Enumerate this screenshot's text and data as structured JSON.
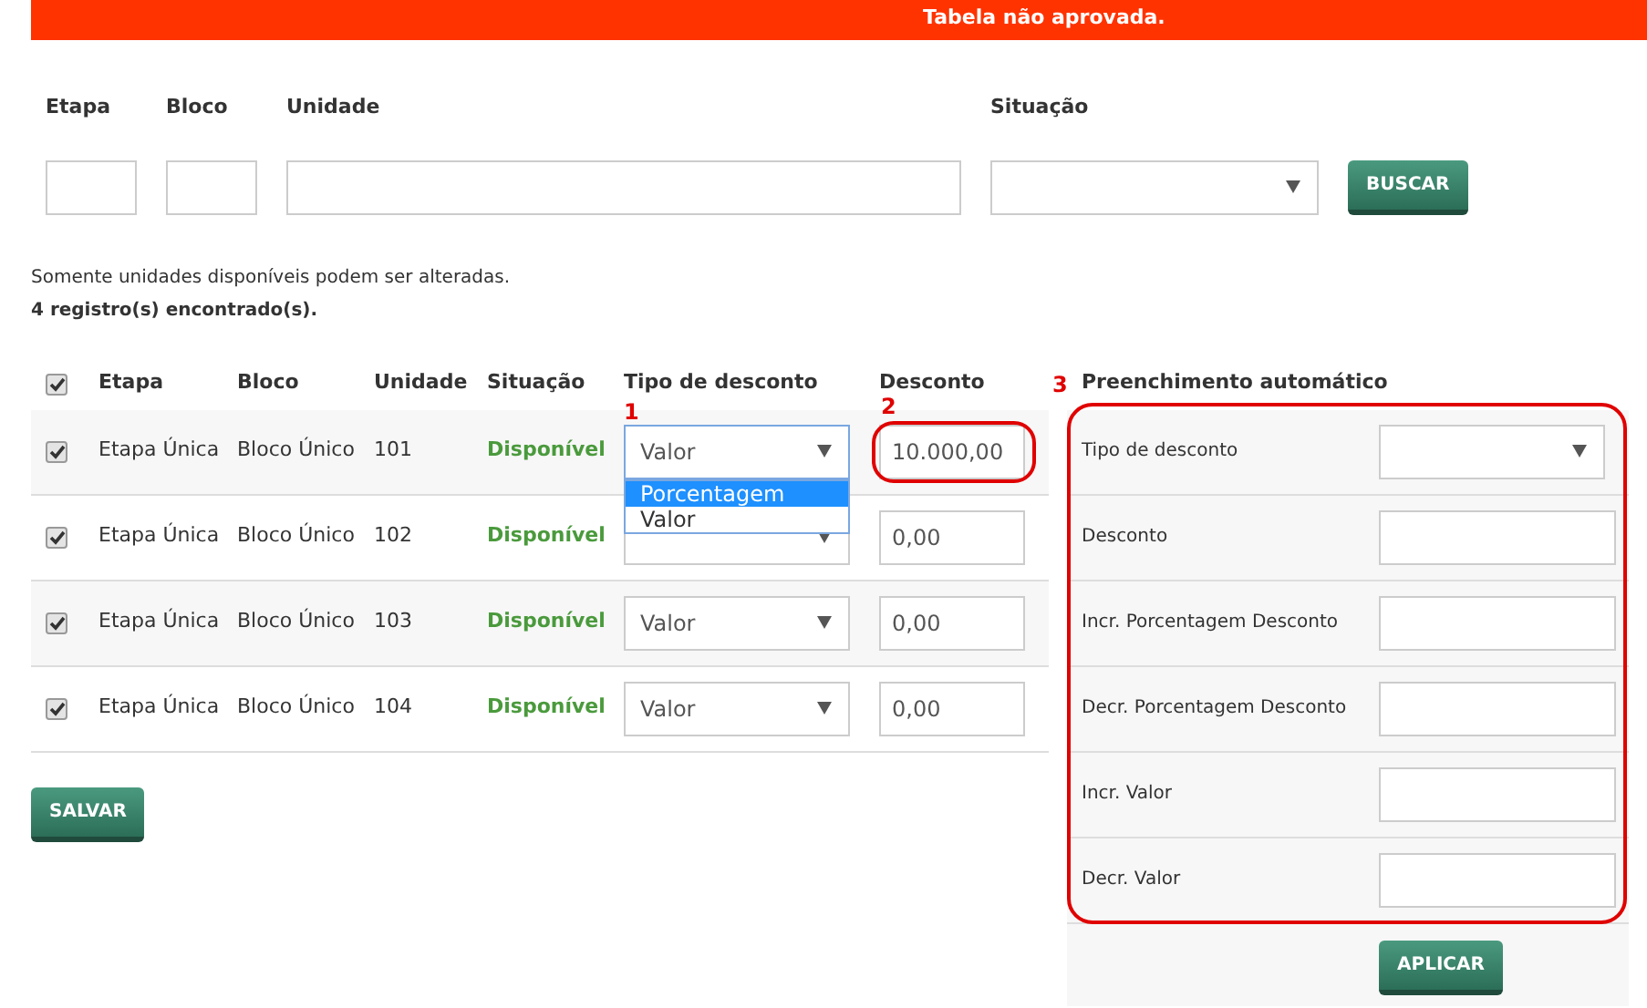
{
  "banner": {
    "text": "Tabela não aprovada."
  },
  "filters": [
    {
      "label": "Etapa",
      "kind": "text"
    },
    {
      "label": "Bloco",
      "kind": "text"
    },
    {
      "label": "Unidade",
      "kind": "text"
    },
    {
      "label": "Situação",
      "kind": "select"
    }
  ],
  "search_button": "BUSCAR",
  "info": "Somente unidades disponíveis podem ser alteradas.",
  "count": "4 registro(s) encontrado(s).",
  "table": {
    "select_all_checked": true,
    "columns": [
      "Etapa",
      "Bloco",
      "Unidade",
      "Situação",
      "Tipo de desconto",
      "Desconto"
    ],
    "rows": [
      {
        "checked": true,
        "etapa": "Etapa Única",
        "bloco": "Bloco Único",
        "unidade": "101",
        "situacao": "Disponível",
        "tipo": "Valor",
        "desconto": "10.000,00",
        "open_options": [
          {
            "label": "Porcentagem",
            "selected": true
          },
          {
            "label": "Valor",
            "selected": false
          }
        ]
      },
      {
        "checked": true,
        "etapa": "Etapa Única",
        "bloco": "Bloco Único",
        "unidade": "102",
        "situacao": "Disponível",
        "desconto": "0,00"
      },
      {
        "checked": true,
        "etapa": "Etapa Única",
        "bloco": "Bloco Único",
        "unidade": "103",
        "situacao": "Disponível",
        "tipo": "Valor",
        "desconto": "0,00"
      },
      {
        "checked": true,
        "etapa": "Etapa Única",
        "bloco": "Bloco Único",
        "unidade": "104",
        "situacao": "Disponível",
        "tipo": "Valor",
        "desconto": "0,00"
      }
    ]
  },
  "save_button": "SALVAR",
  "annotations": [
    "1",
    "2",
    "3"
  ],
  "auto_fill": {
    "title": "Preenchimento automático",
    "fields": [
      {
        "label": "Tipo de desconto",
        "kind": "select"
      },
      {
        "label": "Desconto",
        "kind": "text"
      },
      {
        "label": "Incr. Porcentagem Desconto",
        "kind": "text"
      },
      {
        "label": "Decr. Porcentagem Desconto",
        "kind": "text"
      },
      {
        "label": "Incr. Valor",
        "kind": "text"
      },
      {
        "label": "Decr. Valor",
        "kind": "text"
      }
    ],
    "button": "APLICAR"
  }
}
